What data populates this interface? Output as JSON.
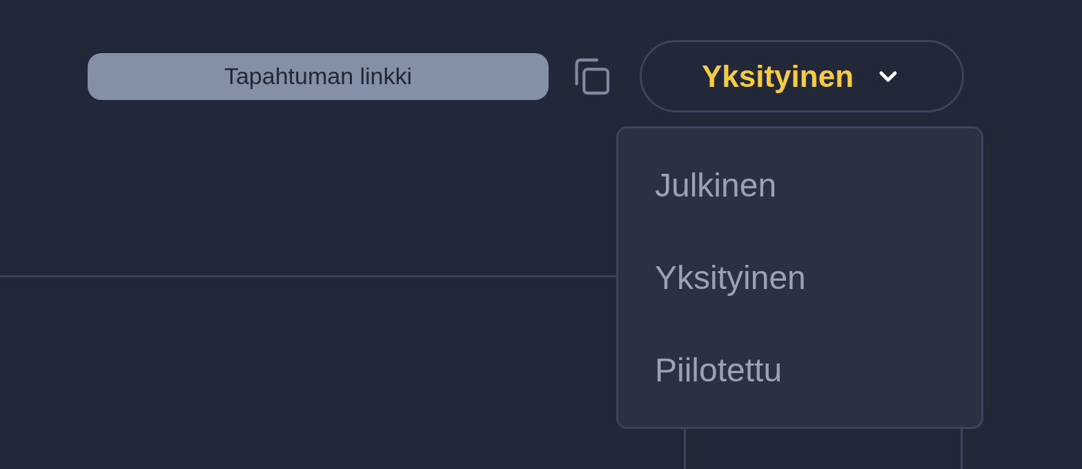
{
  "link_field": {
    "placeholder": "Tapahtuman linkki"
  },
  "visibility_dropdown": {
    "value": "Yksityinen"
  },
  "visibility_menu": {
    "items": [
      {
        "label": "Julkinen"
      },
      {
        "label": "Yksityinen"
      },
      {
        "label": "Piilotettu"
      }
    ]
  }
}
